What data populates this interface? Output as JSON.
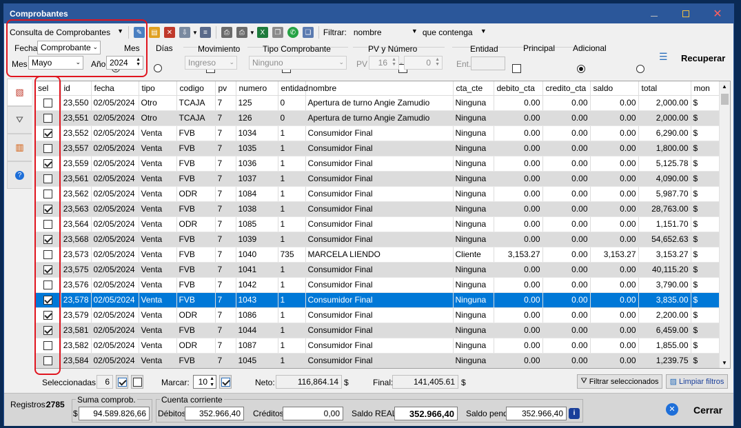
{
  "window": {
    "title": "Comprobantes"
  },
  "toolbar": {
    "mode_select": "Consulta de Comprobantes",
    "filter_label": "Filtrar:",
    "filter_field": "nombre",
    "filter_op": "que contenga"
  },
  "filters": {
    "fecha_label": "Fecha",
    "fecha_select": "Comprobante",
    "mes_radio": "Mes",
    "dias_radio": "Días",
    "mes_label": "Mes",
    "mes_select": "Mayo",
    "anio_label": "Año",
    "anio_value": "2024",
    "movimiento_label": "Movimiento",
    "movimiento_select": "Ingreso",
    "tipo_comp_label": "Tipo Comprobante",
    "tipo_comp_select": "Ninguno",
    "pvnum_label": "PV y Número",
    "pv_label": "PV",
    "pv_value": "16",
    "num_value": "0",
    "entidad_label": "Entidad",
    "principal_radio": "Principal",
    "adicional_radio": "Adicional",
    "ent_label": "Ent.",
    "recuperar": "Recuperar"
  },
  "grid": {
    "columns": [
      "sel",
      "id",
      "fecha",
      "tipo",
      "codigo",
      "pv",
      "numero",
      "entidad",
      "nombre",
      "cta_cte",
      "debito_cta",
      "credito_cta",
      "saldo",
      "total",
      "mon"
    ],
    "rows": [
      {
        "sel": false,
        "id": "23,550",
        "fecha": "02/05/2024",
        "tipo": "Otro",
        "codigo": "TCAJA",
        "pv": "7",
        "numero": "125",
        "entidad": "0",
        "nombre": "Apertura de turno Angie Zamudio",
        "cta_cte": "Ninguna",
        "debito": "0.00",
        "credito": "0.00",
        "saldo": "0.00",
        "total": "2,000.00",
        "mon": "$"
      },
      {
        "sel": false,
        "id": "23,551",
        "fecha": "02/05/2024",
        "tipo": "Otro",
        "codigo": "TCAJA",
        "pv": "7",
        "numero": "126",
        "entidad": "0",
        "nombre": "Apertura de turno Angie Zamudio",
        "cta_cte": "Ninguna",
        "debito": "0.00",
        "credito": "0.00",
        "saldo": "0.00",
        "total": "2,000.00",
        "mon": "$"
      },
      {
        "sel": true,
        "id": "23,552",
        "fecha": "02/05/2024",
        "tipo": "Venta",
        "codigo": "FVB",
        "pv": "7",
        "numero": "1034",
        "entidad": "1",
        "nombre": "Consumidor Final",
        "cta_cte": "Ninguna",
        "debito": "0.00",
        "credito": "0.00",
        "saldo": "0.00",
        "total": "6,290.00",
        "mon": "$"
      },
      {
        "sel": false,
        "id": "23,557",
        "fecha": "02/05/2024",
        "tipo": "Venta",
        "codigo": "FVB",
        "pv": "7",
        "numero": "1035",
        "entidad": "1",
        "nombre": "Consumidor Final",
        "cta_cte": "Ninguna",
        "debito": "0.00",
        "credito": "0.00",
        "saldo": "0.00",
        "total": "1,800.00",
        "mon": "$"
      },
      {
        "sel": true,
        "id": "23,559",
        "fecha": "02/05/2024",
        "tipo": "Venta",
        "codigo": "FVB",
        "pv": "7",
        "numero": "1036",
        "entidad": "1",
        "nombre": "Consumidor Final",
        "cta_cte": "Ninguna",
        "debito": "0.00",
        "credito": "0.00",
        "saldo": "0.00",
        "total": "5,125.78",
        "mon": "$"
      },
      {
        "sel": false,
        "id": "23,561",
        "fecha": "02/05/2024",
        "tipo": "Venta",
        "codigo": "FVB",
        "pv": "7",
        "numero": "1037",
        "entidad": "1",
        "nombre": "Consumidor Final",
        "cta_cte": "Ninguna",
        "debito": "0.00",
        "credito": "0.00",
        "saldo": "0.00",
        "total": "4,090.00",
        "mon": "$"
      },
      {
        "sel": false,
        "id": "23,562",
        "fecha": "02/05/2024",
        "tipo": "Venta",
        "codigo": "ODR",
        "pv": "7",
        "numero": "1084",
        "entidad": "1",
        "nombre": "Consumidor Final",
        "cta_cte": "Ninguna",
        "debito": "0.00",
        "credito": "0.00",
        "saldo": "0.00",
        "total": "5,987.70",
        "mon": "$"
      },
      {
        "sel": true,
        "id": "23,563",
        "fecha": "02/05/2024",
        "tipo": "Venta",
        "codigo": "FVB",
        "pv": "7",
        "numero": "1038",
        "entidad": "1",
        "nombre": "Consumidor Final",
        "cta_cte": "Ninguna",
        "debito": "0.00",
        "credito": "0.00",
        "saldo": "0.00",
        "total": "28,763.00",
        "mon": "$"
      },
      {
        "sel": false,
        "id": "23,564",
        "fecha": "02/05/2024",
        "tipo": "Venta",
        "codigo": "ODR",
        "pv": "7",
        "numero": "1085",
        "entidad": "1",
        "nombre": "Consumidor Final",
        "cta_cte": "Ninguna",
        "debito": "0.00",
        "credito": "0.00",
        "saldo": "0.00",
        "total": "1,151.70",
        "mon": "$"
      },
      {
        "sel": true,
        "id": "23,568",
        "fecha": "02/05/2024",
        "tipo": "Venta",
        "codigo": "FVB",
        "pv": "7",
        "numero": "1039",
        "entidad": "1",
        "nombre": "Consumidor Final",
        "cta_cte": "Ninguna",
        "debito": "0.00",
        "credito": "0.00",
        "saldo": "0.00",
        "total": "54,652.63",
        "mon": "$"
      },
      {
        "sel": false,
        "id": "23,573",
        "fecha": "02/05/2024",
        "tipo": "Venta",
        "codigo": "FVB",
        "pv": "7",
        "numero": "1040",
        "entidad": "735",
        "nombre": "MARCELA LIENDO",
        "cta_cte": "Cliente",
        "debito": "3,153.27",
        "credito": "0.00",
        "saldo": "3,153.27",
        "total": "3,153.27",
        "mon": "$"
      },
      {
        "sel": true,
        "id": "23,575",
        "fecha": "02/05/2024",
        "tipo": "Venta",
        "codigo": "FVB",
        "pv": "7",
        "numero": "1041",
        "entidad": "1",
        "nombre": "Consumidor Final",
        "cta_cte": "Ninguna",
        "debito": "0.00",
        "credito": "0.00",
        "saldo": "0.00",
        "total": "40,115.20",
        "mon": "$"
      },
      {
        "sel": false,
        "id": "23,576",
        "fecha": "02/05/2024",
        "tipo": "Venta",
        "codigo": "FVB",
        "pv": "7",
        "numero": "1042",
        "entidad": "1",
        "nombre": "Consumidor Final",
        "cta_cte": "Ninguna",
        "debito": "0.00",
        "credito": "0.00",
        "saldo": "0.00",
        "total": "3,790.00",
        "mon": "$"
      },
      {
        "sel": true,
        "id": "23,578",
        "fecha": "02/05/2024",
        "tipo": "Venta",
        "codigo": "FVB",
        "pv": "7",
        "numero": "1043",
        "entidad": "1",
        "nombre": "Consumidor Final",
        "cta_cte": "Ninguna",
        "debito": "0.00",
        "credito": "0.00",
        "saldo": "0.00",
        "total": "3,835.00",
        "mon": "$",
        "current": true
      },
      {
        "sel": true,
        "id": "23,579",
        "fecha": "02/05/2024",
        "tipo": "Venta",
        "codigo": "ODR",
        "pv": "7",
        "numero": "1086",
        "entidad": "1",
        "nombre": "Consumidor Final",
        "cta_cte": "Ninguna",
        "debito": "0.00",
        "credito": "0.00",
        "saldo": "0.00",
        "total": "2,200.00",
        "mon": "$"
      },
      {
        "sel": true,
        "id": "23,581",
        "fecha": "02/05/2024",
        "tipo": "Venta",
        "codigo": "FVB",
        "pv": "7",
        "numero": "1044",
        "entidad": "1",
        "nombre": "Consumidor Final",
        "cta_cte": "Ninguna",
        "debito": "0.00",
        "credito": "0.00",
        "saldo": "0.00",
        "total": "6,459.00",
        "mon": "$"
      },
      {
        "sel": false,
        "id": "23,582",
        "fecha": "02/05/2024",
        "tipo": "Venta",
        "codigo": "ODR",
        "pv": "7",
        "numero": "1087",
        "entidad": "1",
        "nombre": "Consumidor Final",
        "cta_cte": "Ninguna",
        "debito": "0.00",
        "credito": "0.00",
        "saldo": "0.00",
        "total": "1,855.00",
        "mon": "$"
      },
      {
        "sel": false,
        "id": "23,584",
        "fecha": "02/05/2024",
        "tipo": "Venta",
        "codigo": "FVB",
        "pv": "7",
        "numero": "1045",
        "entidad": "1",
        "nombre": "Consumidor Final",
        "cta_cte": "Ninguna",
        "debito": "0.00",
        "credito": "0.00",
        "saldo": "0.00",
        "total": "1,239.75",
        "mon": "$"
      }
    ]
  },
  "selection": {
    "seleccionadas_label": "Seleccionadas:",
    "seleccionadas_value": "6",
    "marcar_label": "Marcar:",
    "marcar_value": "10",
    "neto_label": "Neto:",
    "neto_value": "116,864.14",
    "neto_unit": "$",
    "final_label": "Final:",
    "final_value": "141,405.61",
    "final_unit": "$",
    "filtrar_sel": "Filtrar seleccionados",
    "limpiar": "Limpiar filtros"
  },
  "footer": {
    "registros_label": "Registros:",
    "registros_value": "2785",
    "suma_label": "Suma comprob.",
    "suma_unit": "$",
    "suma_value": "94.589.826,66",
    "cc_label": "Cuenta corriente",
    "debitos_label": "Débitos",
    "debitos_value": "352.966,40",
    "creditos_label": "Créditos",
    "creditos_value": "0,00",
    "saldo_real_label": "Saldo REAL",
    "saldo_real_value": "352.966,40",
    "saldo_pend_label": "Saldo pend.",
    "saldo_pend_value": "352.966,40",
    "cerrar": "Cerrar"
  },
  "colors": {
    "titlebar": "#2b579a",
    "selection": "#0078d7",
    "highlight": "#e0141e"
  }
}
